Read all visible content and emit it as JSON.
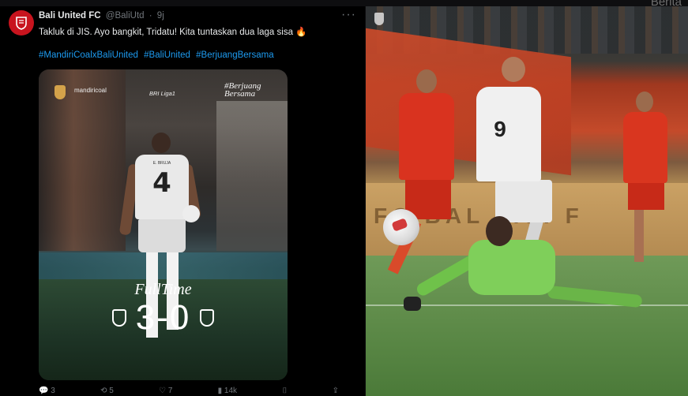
{
  "corner_text": "Berita",
  "tweet": {
    "author_name": "Bali United FC",
    "author_handle": "@BaliUtd",
    "separator": "·",
    "time": "9j",
    "more": "···",
    "text": "Takluk di JIS. Ayo bangkit, Tridatu! Kita tuntaskan dua laga sisa 🔥",
    "hashtags": [
      "#MandiriCoalxBaliUnited",
      "#BaliUnited",
      "#BerjuangBersama"
    ],
    "image": {
      "sponsor": "mandiricoal",
      "league": "BRI Liga1",
      "hashtag": "#Berjuang Bersama",
      "player_name": "E. BRUJA",
      "player_number": "4",
      "fulltime_label": "FullTime",
      "score": "3-0"
    },
    "actions": {
      "reply": "3",
      "retweet": "5",
      "like": "7",
      "views": "14k",
      "bookmark": "",
      "share": ""
    }
  },
  "photo": {
    "adboard_text": "FO  BAL  FISI  F",
    "player_number": "9"
  },
  "colors": {
    "background": "#000000",
    "link": "#1d9bf0",
    "muted": "#71767b",
    "brand_red": "#c8141e"
  }
}
